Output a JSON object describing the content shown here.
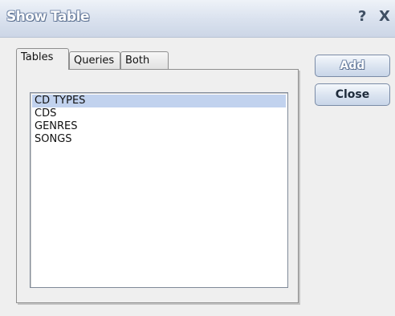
{
  "window": {
    "title": "Show Table",
    "help_glyph": "?",
    "close_glyph": "X"
  },
  "tabs": [
    {
      "label": "Tables",
      "active": true
    },
    {
      "label": "Queries",
      "active": false
    },
    {
      "label": "Both",
      "active": false
    }
  ],
  "list": {
    "items": [
      "CD TYPES",
      "CDS",
      "GENRES",
      "SONGS"
    ],
    "selected": "CD TYPES"
  },
  "buttons": {
    "add_label": "Add",
    "close_label": "Close"
  },
  "colors": {
    "selection": "#c1d2ee",
    "dialog_bg": "#efefef",
    "titlebar": "#d9e1ee"
  }
}
